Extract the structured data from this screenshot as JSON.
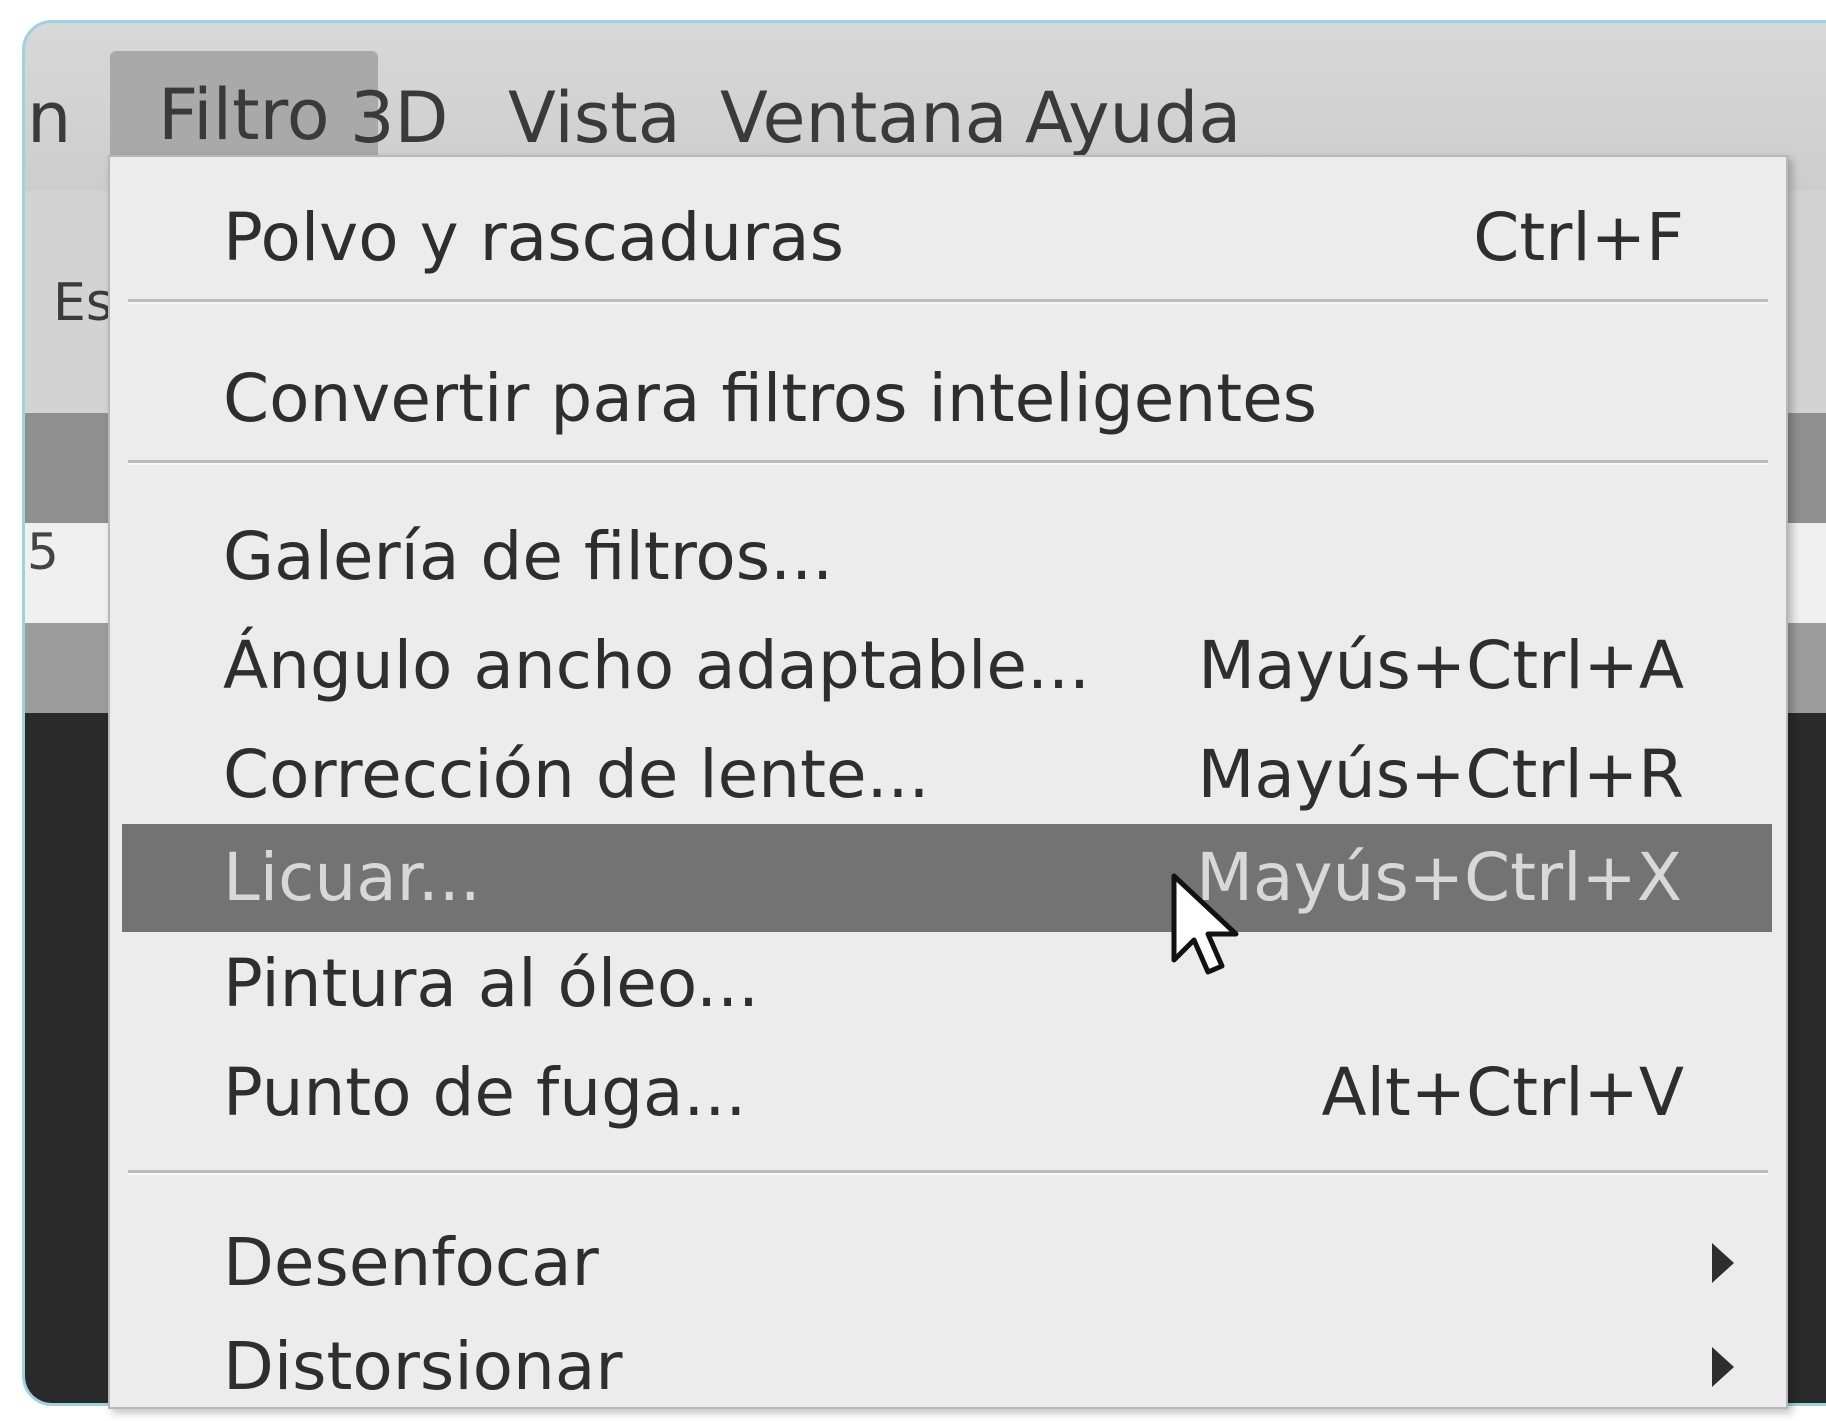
{
  "menubar": {
    "clipped_item": "n",
    "items": [
      {
        "label": "Filtro",
        "active": true
      },
      {
        "label": "3D"
      },
      {
        "label": "Vista"
      },
      {
        "label": "Ventana"
      },
      {
        "label": "Ayuda"
      }
    ]
  },
  "options_bar": {
    "clipped_text": "Es"
  },
  "ruler": {
    "clipped_text": "5"
  },
  "filter_menu": {
    "items": [
      {
        "label": "Polvo y rascaduras",
        "shortcut": "Ctrl+F"
      },
      {
        "label": "Convertir para filtros inteligentes",
        "shortcut": ""
      },
      {
        "label": "Galería de filtros...",
        "shortcut": ""
      },
      {
        "label": "Ángulo ancho adaptable...",
        "shortcut": "Mayús+Ctrl+A"
      },
      {
        "label": "Corrección de lente...",
        "shortcut": "Mayús+Ctrl+R"
      },
      {
        "label": "Licuar...",
        "shortcut": "Mayús+Ctrl+X",
        "highlighted": true
      },
      {
        "label": "Pintura al óleo...",
        "shortcut": ""
      },
      {
        "label": "Punto de fuga...",
        "shortcut": "Alt+Ctrl+V"
      },
      {
        "label": "Desenfocar",
        "shortcut": "",
        "submenu": true
      },
      {
        "label": "Distorsionar",
        "shortcut": "",
        "submenu": true
      }
    ]
  },
  "colors": {
    "highlight_bg": "#737373",
    "menu_bg": "#ececec",
    "frame_border": "#9ed3dd"
  },
  "icons": {
    "cursor": "mouse-pointer-icon",
    "submenu": "submenu-arrow-icon"
  }
}
